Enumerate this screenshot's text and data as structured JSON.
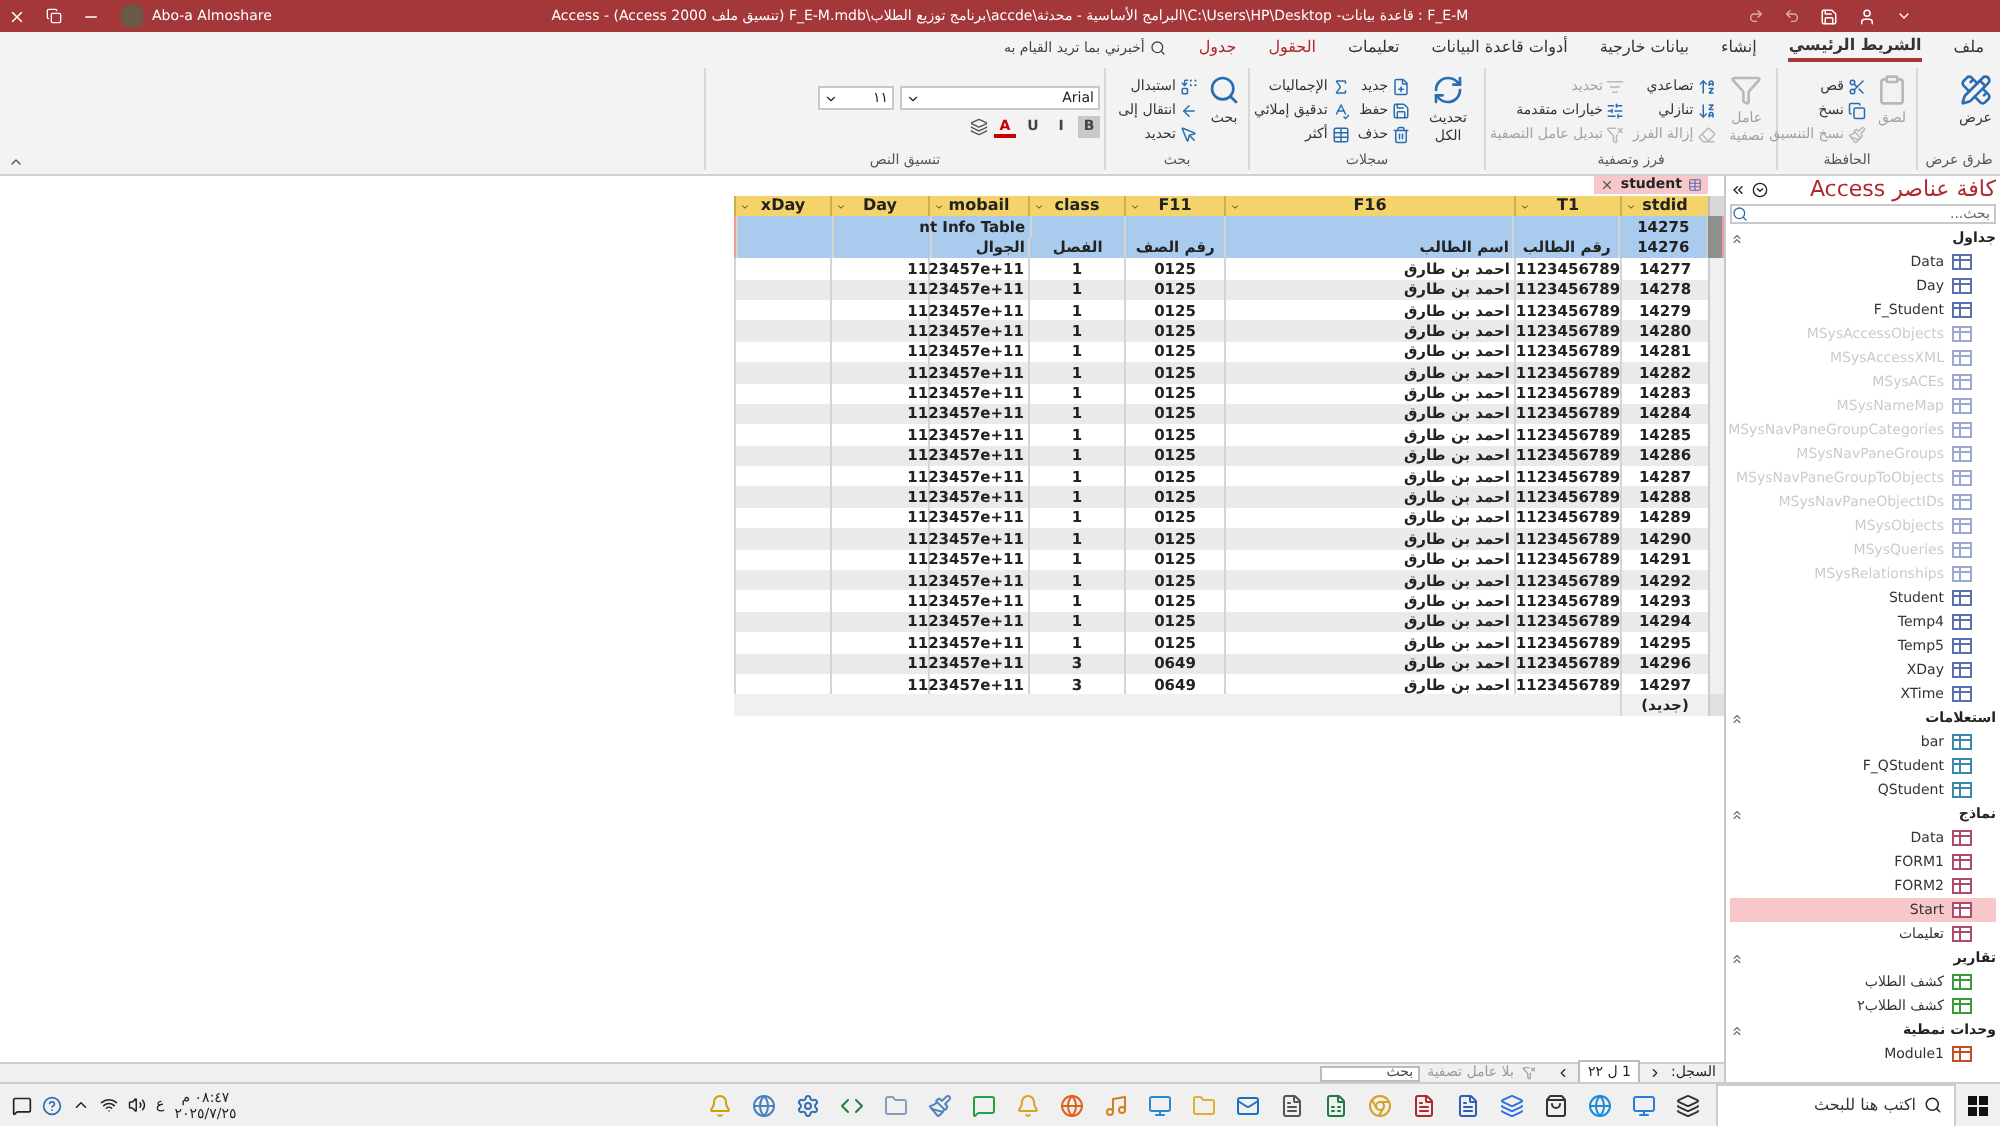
{
  "title_bar": {
    "title": "F_E-M : قاعدة بيانات- C:\\Users\\HP\\Desktop\\البرامج الأساسية - محدثة\\accde\\برنامج توزيع الطلاب\\F_E-M.mdb (تنسيق ملف Access 2000) - Access",
    "user": "Abo-a Almoshare"
  },
  "ribbon_tabs": [
    {
      "label": "ملف",
      "selected": false,
      "kind": "plain"
    },
    {
      "label": "الشريط الرئيسي",
      "selected": true,
      "kind": "plain"
    },
    {
      "label": "إنشاء",
      "selected": false,
      "kind": "plain"
    },
    {
      "label": "بيانات خارجية",
      "selected": false,
      "kind": "plain"
    },
    {
      "label": "أدوات قاعدة البيانات",
      "selected": false,
      "kind": "plain"
    },
    {
      "label": "تعليمات",
      "selected": false,
      "kind": "plain"
    },
    {
      "label": "الحقول",
      "selected": false,
      "kind": "context"
    },
    {
      "label": "جدول",
      "selected": false,
      "kind": "context"
    }
  ],
  "tell_me": {
    "prompt": "أخبرني بما تريد القيام به"
  },
  "ribbon_groups": [
    {
      "label": "طرق عرض",
      "buttons": [
        {
          "label": "عرض",
          "kind": "large",
          "disabled": false
        }
      ]
    },
    {
      "label": "الحافظة",
      "buttons": [
        {
          "label": "لصق",
          "kind": "large",
          "disabled": true
        },
        {
          "label": "قص",
          "kind": "small",
          "disabled": false
        },
        {
          "label": "نسخ",
          "kind": "small",
          "disabled": false
        },
        {
          "label": "نسخ التنسيق",
          "kind": "small",
          "disabled": true
        }
      ]
    },
    {
      "label": "فرز وتصفية",
      "buttons": [
        {
          "label": "عامل تصفية",
          "kind": "large",
          "disabled": true
        },
        {
          "label": "تصاعدي",
          "kind": "small",
          "disabled": false
        },
        {
          "label": "تنازلي",
          "kind": "small",
          "disabled": false
        },
        {
          "label": "إزالة الفرز",
          "kind": "small",
          "disabled": true
        },
        {
          "label": "تحديد",
          "kind": "small",
          "disabled": true
        },
        {
          "label": "خيارات متقدمة",
          "kind": "small",
          "disabled": false
        },
        {
          "label": "تبديل عامل التصفية",
          "kind": "small",
          "disabled": true
        }
      ]
    },
    {
      "label": "سجلات",
      "buttons": [
        {
          "label": "تحديث الكل",
          "kind": "large",
          "disabled": false
        },
        {
          "label": "جديد",
          "kind": "small",
          "disabled": false
        },
        {
          "label": "حفظ",
          "kind": "small",
          "disabled": false
        },
        {
          "label": "حذف",
          "kind": "small",
          "disabled": false
        },
        {
          "label": "الإجماليات",
          "kind": "small",
          "disabled": false
        },
        {
          "label": "تدقيق إملائي",
          "kind": "small",
          "disabled": false
        },
        {
          "label": "أكثر",
          "kind": "small",
          "disabled": false
        }
      ]
    },
    {
      "label": "بحث",
      "buttons": [
        {
          "label": "بحث",
          "kind": "large",
          "disabled": false
        },
        {
          "label": "استبدال",
          "kind": "small",
          "disabled": false
        },
        {
          "label": "انتقال إلى",
          "kind": "small",
          "disabled": false
        },
        {
          "label": "تحديد",
          "kind": "small",
          "disabled": false
        }
      ]
    },
    {
      "label": "تنسيق النص",
      "font": "Arial",
      "size": "١١",
      "format_buttons": [
        {
          "label": "B",
          "selected": true
        },
        {
          "label": "I",
          "selected": false
        },
        {
          "label": "U",
          "selected": false
        },
        {
          "label": "A",
          "selected": false
        }
      ]
    }
  ],
  "document_tab": {
    "label": "student"
  },
  "table": {
    "columns": [
      "stdid",
      "T1",
      "F16",
      "F11",
      "class",
      "mobail",
      "Day",
      "xDay"
    ],
    "rows": [
      {
        "selected": true,
        "cells": [
          "14275",
          null,
          null,
          null,
          null,
          "nt Info Table",
          null,
          null
        ]
      },
      {
        "selected": true,
        "cells": [
          "14276",
          "رقم الطالب",
          "اسم الطالب",
          "رقم الصف",
          "الفصل",
          "الجوال",
          null,
          null
        ]
      },
      {
        "selected": false,
        "cells": [
          "14277",
          "1123456789",
          "احمد بن طارق",
          "0125",
          "1",
          "1123457e+11",
          null,
          null
        ]
      },
      {
        "selected": false,
        "cells": [
          "14278",
          "1123456789",
          "احمد بن طارق",
          "0125",
          "1",
          "1123457e+11",
          null,
          null
        ]
      },
      {
        "selected": false,
        "cells": [
          "14279",
          "1123456789",
          "احمد بن طارق",
          "0125",
          "1",
          "1123457e+11",
          null,
          null
        ]
      },
      {
        "selected": false,
        "cells": [
          "14280",
          "1123456789",
          "احمد بن طارق",
          "0125",
          "1",
          "1123457e+11",
          null,
          null
        ]
      },
      {
        "selected": false,
        "cells": [
          "14281",
          "1123456789",
          "احمد بن طارق",
          "0125",
          "1",
          "1123457e+11",
          null,
          null
        ]
      },
      {
        "selected": false,
        "cells": [
          "14282",
          "1123456789",
          "احمد بن طارق",
          "0125",
          "1",
          "1123457e+11",
          null,
          null
        ]
      },
      {
        "selected": false,
        "cells": [
          "14283",
          "1123456789",
          "احمد بن طارق",
          "0125",
          "1",
          "1123457e+11",
          null,
          null
        ]
      },
      {
        "selected": false,
        "cells": [
          "14284",
          "1123456789",
          "احمد بن طارق",
          "0125",
          "1",
          "1123457e+11",
          null,
          null
        ]
      },
      {
        "selected": false,
        "cells": [
          "14285",
          "1123456789",
          "احمد بن طارق",
          "0125",
          "1",
          "1123457e+11",
          null,
          null
        ]
      },
      {
        "selected": false,
        "cells": [
          "14286",
          "1123456789",
          "احمد بن طارق",
          "0125",
          "1",
          "1123457e+11",
          null,
          null
        ]
      },
      {
        "selected": false,
        "cells": [
          "14287",
          "1123456789",
          "احمد بن طارق",
          "0125",
          "1",
          "1123457e+11",
          null,
          null
        ]
      },
      {
        "selected": false,
        "cells": [
          "14288",
          "1123456789",
          "احمد بن طارق",
          "0125",
          "1",
          "1123457e+11",
          null,
          null
        ]
      },
      {
        "selected": false,
        "cells": [
          "14289",
          "1123456789",
          "احمد بن طارق",
          "0125",
          "1",
          "1123457e+11",
          null,
          null
        ]
      },
      {
        "selected": false,
        "cells": [
          "14290",
          "1123456789",
          "احمد بن طارق",
          "0125",
          "1",
          "1123457e+11",
          null,
          null
        ]
      },
      {
        "selected": false,
        "cells": [
          "14291",
          "1123456789",
          "احمد بن طارق",
          "0125",
          "1",
          "1123457e+11",
          null,
          null
        ]
      },
      {
        "selected": false,
        "cells": [
          "14292",
          "1123456789",
          "احمد بن طارق",
          "0125",
          "1",
          "1123457e+11",
          null,
          null
        ]
      },
      {
        "selected": false,
        "cells": [
          "14293",
          "1123456789",
          "احمد بن طارق",
          "0125",
          "1",
          "1123457e+11",
          null,
          null
        ]
      },
      {
        "selected": false,
        "cells": [
          "14294",
          "1123456789",
          "احمد بن طارق",
          "0125",
          "1",
          "1123457e+11",
          null,
          null
        ]
      },
      {
        "selected": false,
        "cells": [
          "14295",
          "1123456789",
          "احمد بن طارق",
          "0125",
          "1",
          "1123457e+11",
          null,
          null
        ]
      },
      {
        "selected": false,
        "cells": [
          "14296",
          "1123456789",
          "احمد بن طارق",
          "0649",
          "3",
          "1123457e+11",
          null,
          null
        ]
      },
      {
        "selected": false,
        "cells": [
          "14297",
          "1123456789",
          "احمد بن طارق",
          "0649",
          "3",
          "1123457e+11",
          null,
          null
        ]
      }
    ],
    "new_row": "(جديد)"
  },
  "record_nav": {
    "label": "السجل:",
    "position": "1 ل ٢٢",
    "filter": "بلا عامل تصفية",
    "placeholder": "بحث"
  },
  "nav_pane": {
    "title": "كافة عناصر Access",
    "search": {
      "placeholder": "بحث..."
    },
    "groups": [
      {
        "label": "جداول",
        "items": [
          {
            "label": "Data",
            "kind": "table",
            "hidden": false,
            "selected": false
          },
          {
            "label": "Day",
            "kind": "table",
            "hidden": false,
            "selected": false
          },
          {
            "label": "F_Student",
            "kind": "table",
            "hidden": false,
            "selected": false
          },
          {
            "label": "MSysAccessObjects",
            "kind": "table",
            "hidden": true,
            "selected": false
          },
          {
            "label": "MSysAccessXML",
            "kind": "table",
            "hidden": true,
            "selected": false
          },
          {
            "label": "MSysACEs",
            "kind": "table",
            "hidden": true,
            "selected": false
          },
          {
            "label": "MSysNameMap",
            "kind": "table",
            "hidden": true,
            "selected": false
          },
          {
            "label": "MSysNavPaneGroupCategories",
            "kind": "table",
            "hidden": true,
            "selected": false
          },
          {
            "label": "MSysNavPaneGroups",
            "kind": "table",
            "hidden": true,
            "selected": false
          },
          {
            "label": "MSysNavPaneGroupToObjects",
            "kind": "table",
            "hidden": true,
            "selected": false
          },
          {
            "label": "MSysNavPaneObjectIDs",
            "kind": "table",
            "hidden": true,
            "selected": false
          },
          {
            "label": "MSysObjects",
            "kind": "table",
            "hidden": true,
            "selected": false
          },
          {
            "label": "MSysQueries",
            "kind": "table",
            "hidden": true,
            "selected": false
          },
          {
            "label": "MSysRelationships",
            "kind": "table",
            "hidden": true,
            "selected": false
          },
          {
            "label": "Student",
            "kind": "table",
            "hidden": false,
            "selected": false
          },
          {
            "label": "Temp4",
            "kind": "table",
            "hidden": false,
            "selected": false
          },
          {
            "label": "Temp5",
            "kind": "table",
            "hidden": false,
            "selected": false
          },
          {
            "label": "XDay",
            "kind": "table",
            "hidden": false,
            "selected": false
          },
          {
            "label": "XTime",
            "kind": "table",
            "hidden": false,
            "selected": false
          }
        ]
      },
      {
        "label": "استعلامات",
        "items": [
          {
            "label": "bar",
            "kind": "query",
            "hidden": false,
            "selected": false
          },
          {
            "label": "F_QStudent",
            "kind": "query",
            "hidden": false,
            "selected": false
          },
          {
            "label": "QStudent",
            "kind": "query",
            "hidden": false,
            "selected": false
          }
        ]
      },
      {
        "label": "نماذج",
        "items": [
          {
            "label": "Data",
            "kind": "form",
            "hidden": false,
            "selected": false
          },
          {
            "label": "FORM1",
            "kind": "form",
            "hidden": false,
            "selected": false
          },
          {
            "label": "FORM2",
            "kind": "form",
            "hidden": false,
            "selected": false
          },
          {
            "label": "Start",
            "kind": "form",
            "hidden": false,
            "selected": true
          },
          {
            "label": "تعليمات",
            "kind": "form",
            "hidden": false,
            "selected": false
          }
        ]
      },
      {
        "label": "تقارير",
        "items": [
          {
            "label": "كشف الطلاب",
            "kind": "report",
            "hidden": false,
            "selected": false
          },
          {
            "label": "كشف الطلاب٢",
            "kind": "report",
            "hidden": false,
            "selected": false
          }
        ]
      },
      {
        "label": "وحدات نمطية",
        "items": [
          {
            "label": "Module1",
            "kind": "module",
            "hidden": false,
            "selected": false
          }
        ]
      }
    ]
  },
  "taskbar": {
    "search": {
      "placeholder": "اكتب هنا للبحث"
    },
    "language": "ع",
    "time": "٠٨:٤٧ م",
    "date": "٢٠٢٥/٧/٢٥"
  }
}
